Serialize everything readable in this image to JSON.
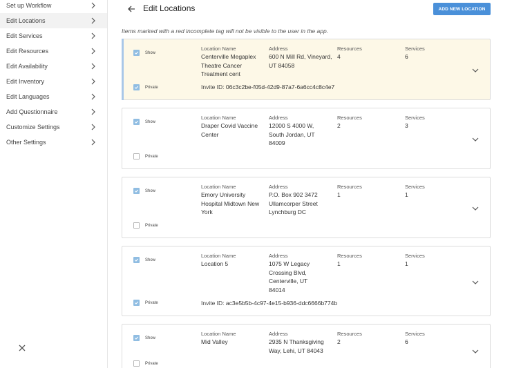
{
  "sidebar": {
    "items": [
      {
        "label": "Set up Workflow",
        "active": false
      },
      {
        "label": "Edit Locations",
        "active": true
      },
      {
        "label": "Edit Services",
        "active": false
      },
      {
        "label": "Edit Resources",
        "active": false
      },
      {
        "label": "Edit Availability",
        "active": false
      },
      {
        "label": "Edit Inventory",
        "active": false
      },
      {
        "label": "Edit Languages",
        "active": false
      },
      {
        "label": "Add Questionnaire",
        "active": false
      },
      {
        "label": "Customize Settings",
        "active": false
      },
      {
        "label": "Other Settings",
        "active": false
      }
    ]
  },
  "header": {
    "title": "Edit Locations",
    "add_button": "ADD NEW LOCATION",
    "note": "Items marked with a red incomplete tag will not be visible to the user in the app."
  },
  "labels": {
    "show": "Show",
    "private": "Private",
    "location_name": "Location Name",
    "address": "Address",
    "resources": "Resources",
    "services": "Services",
    "invite_id": "Invite ID:"
  },
  "locations": [
    {
      "name": "Centerville Megaplex Theatre Cancer Treatment cent",
      "address": "600 N Mill Rd, Vineyard, UT 84058",
      "resources": "4",
      "services": "6",
      "show": true,
      "private": true,
      "invite_id": "06c3c2be-f05d-42d9-87a7-6a6cc4c8c4e7"
    },
    {
      "name": "Draper Covid Vaccine Center",
      "address": "12000 S 4000 W, South Jordan, UT 84009",
      "resources": "2",
      "services": "3",
      "show": true,
      "private": false,
      "invite_id": ""
    },
    {
      "name": "Emory University Hospital Midtown New York",
      "address": "P.O. Box 902 3472 Ullamcorper Street Lynchburg DC",
      "resources": "1",
      "services": "1",
      "show": true,
      "private": false,
      "invite_id": ""
    },
    {
      "name": "Location 5",
      "address": "1075 W Legacy Crossing Blvd, Centerville, UT 84014",
      "resources": "1",
      "services": "1",
      "show": true,
      "private": true,
      "invite_id": "ac3e5b5b-4c97-4e15-b936-ddc6666b774b"
    },
    {
      "name": "Mid Valley",
      "address": "2935 N Thanksgiving Way, Lehi, UT 84043",
      "resources": "2",
      "services": "6",
      "show": true,
      "private": false,
      "invite_id": ""
    }
  ],
  "colors": {
    "accent": "#4a90d9",
    "checkbox_checked": "#90bde2",
    "highlight_bg": "#fdf8e7"
  }
}
